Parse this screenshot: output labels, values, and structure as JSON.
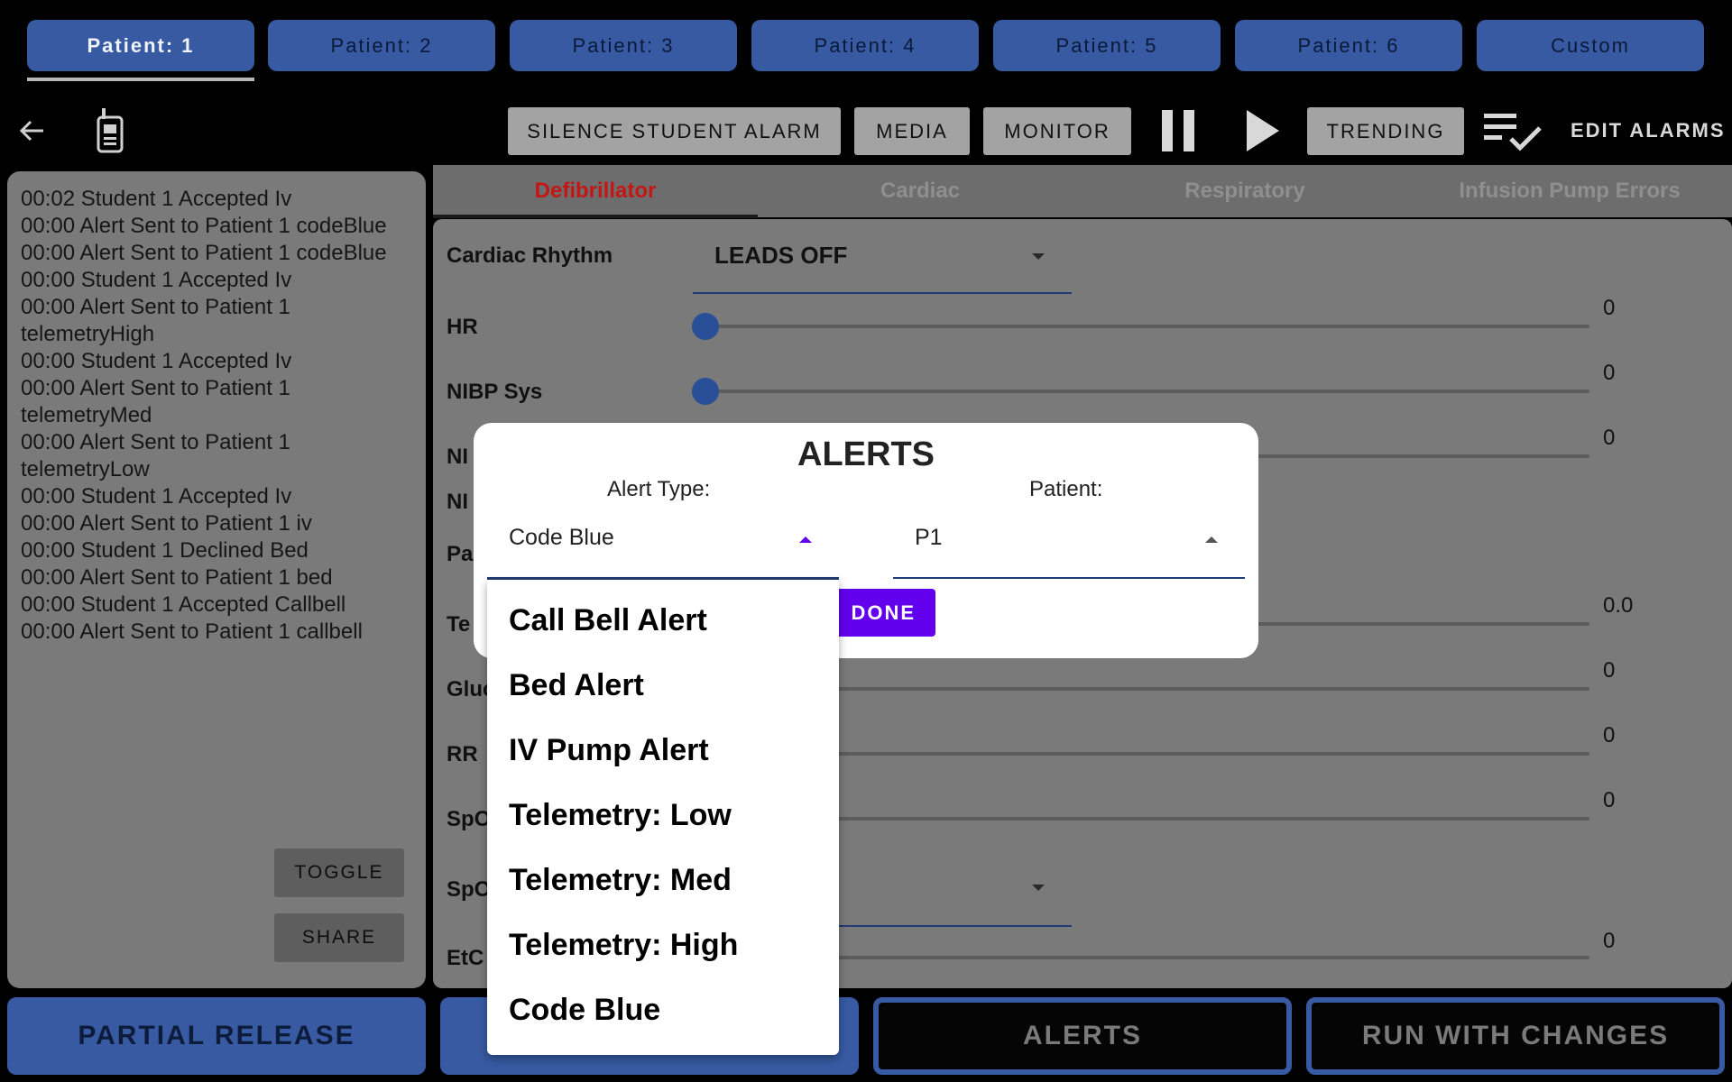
{
  "patient_tabs": [
    "Patient: 1",
    "Patient: 2",
    "Patient: 3",
    "Patient: 4",
    "Patient: 5",
    "Patient: 6",
    "Custom"
  ],
  "toolbar": {
    "silence": "SILENCE STUDENT ALARM",
    "media": "MEDIA",
    "monitor": "MONITOR",
    "trending": "TRENDING",
    "edit_alarms": "EDIT ALARMS",
    "icons": [
      "back-arrow-icon",
      "handheld-device-icon",
      "pause-icon",
      "play-icon",
      "checklist-icon"
    ]
  },
  "log": [
    "00:02 Student 1 Accepted Iv",
    "00:00 Alert Sent to Patient 1 codeBlue",
    "00:00 Alert Sent to Patient 1 codeBlue",
    "00:00 Student 1 Accepted Iv",
    "00:00 Alert Sent to Patient 1 telemetryHigh",
    "00:00 Student 1 Accepted Iv",
    "00:00 Alert Sent to Patient 1 telemetryMed",
    "00:00 Alert Sent to Patient 1 telemetryLow",
    "00:00 Student 1 Accepted Iv",
    "00:00 Alert Sent to Patient 1 iv",
    "00:00 Student 1 Declined Bed",
    "00:00 Alert Sent to Patient 1 bed",
    "00:00 Student 1 Accepted Callbell",
    "00:00 Alert Sent to Patient 1 callbell"
  ],
  "log_buttons": {
    "toggle": "TOGGLE",
    "share": "SHARE"
  },
  "section_tabs": [
    "Defibrillator",
    "Cardiac",
    "Respiratory",
    "Infusion Pump Errors"
  ],
  "rhythm": {
    "label": "Cardiac Rhythm",
    "value": "LEADS OFF"
  },
  "rows": {
    "hr": {
      "label": "HR",
      "value": "0"
    },
    "nibp_sys": {
      "label": "NIBP Sys",
      "value": "0"
    },
    "nibp_dia": {
      "label": "NI",
      "value": "0"
    },
    "nibp_map": {
      "label": "NI"
    },
    "pa": {
      "label": "Pa"
    },
    "temp": {
      "label": "Te",
      "value": "0.0"
    },
    "glucose": {
      "label": "Gluc",
      "value": "0"
    },
    "rr": {
      "label": "RR",
      "value": "0"
    },
    "spo2": {
      "label": "SpO",
      "value": "0"
    },
    "spo2_wave": {
      "label": "SpO"
    },
    "etco2": {
      "label": "EtC",
      "value": "0"
    }
  },
  "bottom_buttons": {
    "partial_release": "PARTIAL RELEASE",
    "alerts": "ALERTS",
    "run_with_changes": "RUN WITH CHANGES"
  },
  "dialog": {
    "title": "ALERTS",
    "alert_type_label": "Alert Type:",
    "alert_type_value": "Code Blue",
    "patient_label": "Patient:",
    "patient_value": "P1",
    "done": "DONE"
  },
  "alert_type_options": [
    "Call Bell Alert",
    "Bed Alert",
    "IV Pump Alert",
    "Telemetry: Low",
    "Telemetry: Med",
    "Telemetry: High",
    "Code Blue"
  ],
  "colors": {
    "accent": "#375aa2",
    "active_tab": "#c51616",
    "primary_button": "#6200ee"
  }
}
